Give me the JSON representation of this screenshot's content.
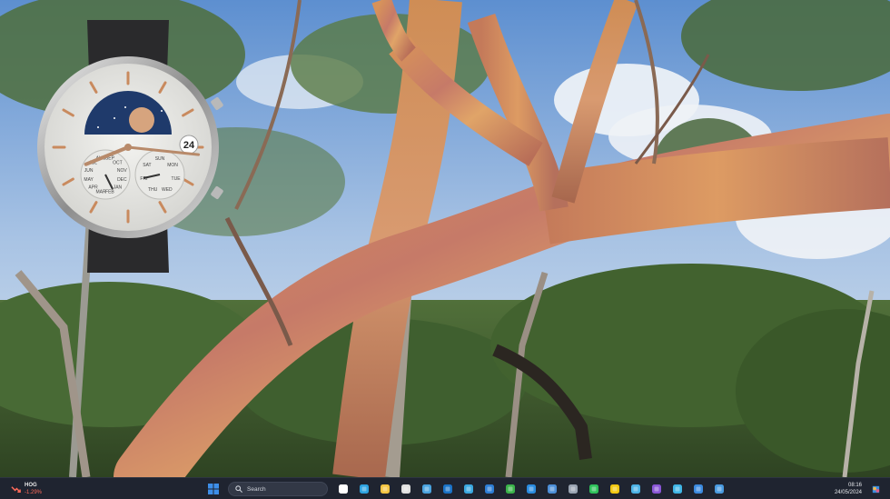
{
  "wallpaper": {
    "description_icon": "rainbow-eucalyptus-wallpaper",
    "colors": {
      "sky": "#7fa3c8",
      "foliage_dark": "#3e5a30",
      "trunk_orange": "#cf8a4c",
      "trunk_pink": "#c77a6a"
    }
  },
  "watch": {
    "date": "24",
    "months": [
      "JUL",
      "AUG",
      "SEP",
      "OCT",
      "NOV",
      "DEC",
      "JAN",
      "FEB",
      "MAR",
      "APR",
      "MAY",
      "JUN"
    ],
    "weekdays": [
      "SUN",
      "MON",
      "TUE",
      "WED",
      "THU",
      "FRI",
      "SAT"
    ],
    "time_hour": 8,
    "time_minute": 16,
    "colors": {
      "face": "#e6e6e3",
      "index": "#c98a5e",
      "moon_sky": "#1f3a6b",
      "strap": "#2a2a2c"
    }
  },
  "taskbar": {
    "weather": {
      "title": "HOG",
      "change": "-1.29%",
      "icon": "stock-down-icon"
    },
    "search": {
      "label": "Search",
      "icon": "search-icon"
    },
    "apps": [
      {
        "name": "start-icon",
        "color": "#3d8ee8"
      },
      {
        "name": "task-view-icon",
        "color": "#ffffff"
      },
      {
        "name": "edge-icon",
        "color": "#2ea3e0"
      },
      {
        "name": "file-explorer-icon",
        "color": "#f4c542"
      },
      {
        "name": "calendar-icon",
        "color": "#e0e0e0"
      },
      {
        "name": "terminal-icon",
        "color": "#4aa3df"
      },
      {
        "name": "outlook-icon",
        "color": "#1a73c7"
      },
      {
        "name": "onedrive-icon",
        "color": "#3aa8e0"
      },
      {
        "name": "app-blue-icon",
        "color": "#2d7ed6"
      },
      {
        "name": "xbox-icon",
        "color": "#3bb34a"
      },
      {
        "name": "vscode-icon",
        "color": "#2a8ce0"
      },
      {
        "name": "mail-icon",
        "color": "#4c8fd8"
      },
      {
        "name": "settings-icon",
        "color": "#9aa4b2"
      },
      {
        "name": "whatsapp-icon",
        "color": "#2fc25b"
      },
      {
        "name": "powerbi-icon",
        "color": "#f2c811"
      },
      {
        "name": "globe-icon",
        "color": "#4cb3e6"
      },
      {
        "name": "purple-app-icon",
        "color": "#8a56d6"
      },
      {
        "name": "app-cyan-icon",
        "color": "#3fb6e6"
      },
      {
        "name": "remote-desktop-icon",
        "color": "#3c8be0"
      },
      {
        "name": "mixer-icon",
        "color": "#4a9be0"
      }
    ],
    "clock": {
      "time": "08:16",
      "date": "24/05/2024"
    },
    "notification_icon": "copilot-icon"
  }
}
